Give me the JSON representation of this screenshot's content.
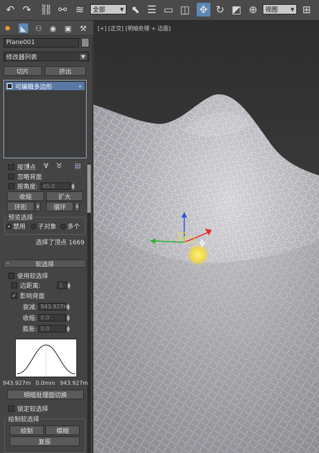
{
  "toolbar": {
    "selection_filter": "全部",
    "reference_coord": "视图",
    "icons": [
      "undo-icon",
      "redo-icon",
      "link-icon",
      "unlink-icon",
      "bind-space-warp-icon",
      "select-object-icon",
      "select-by-name-icon",
      "rect-selection-region-icon",
      "window-crossing-icon",
      "select-and-move-icon",
      "select-and-rotate-icon",
      "select-and-scale-icon",
      "pivot-center-icon"
    ]
  },
  "panel": {
    "tabs": [
      "create-tab-icon",
      "modify-tab-icon",
      "hierarchy-tab-icon",
      "motion-tab-icon",
      "display-tab-icon",
      "utilities-tab-icon"
    ],
    "object_name": "Plane001",
    "object_color": "#8a8a8a",
    "modifier_list": "修改器列表",
    "btn_slice": "切片",
    "btn_extrude": "挤出",
    "stack_item": "可编辑多边形",
    "stack_plus": "+",
    "selection": {
      "by_vertex": "按顶点",
      "ignore_backfacing": "忽略背面",
      "by_angle": "按角度:",
      "angle_value": "45.0",
      "shrink": "收缩",
      "grow": "扩大",
      "ring": "环形",
      "loop": "循环",
      "preview_title": "预览选择",
      "preview_disabled": "禁用",
      "preview_subobject": "子对象",
      "preview_multi": "多个",
      "status": "选择了顶点 1669"
    },
    "soft_selection": {
      "title": "软选择",
      "use_soft": "使用软选择",
      "edge_distance": "边距离:",
      "edge_value": "1",
      "affect_backfacing": "影响背面",
      "falloff_label": "衰减:",
      "falloff_value": "943.927m",
      "pinch_label": "收缩:",
      "pinch_value": "0.0",
      "bubble_label": "膨胀:",
      "bubble_value": "0.0",
      "curve_left": "943.927m",
      "curve_center": "0.0mm",
      "curve_right": "943.927m",
      "shaded_face_toggle": "明暗处理面切换",
      "lock_soft": "锁定软选择",
      "paint_title": "绘制软选择",
      "paint": "绘制",
      "blur": "模糊",
      "revert": "复原"
    }
  },
  "viewport": {
    "label": "[+] [正交] [明暗处理 + 边面]",
    "accent": "#5878a6"
  }
}
